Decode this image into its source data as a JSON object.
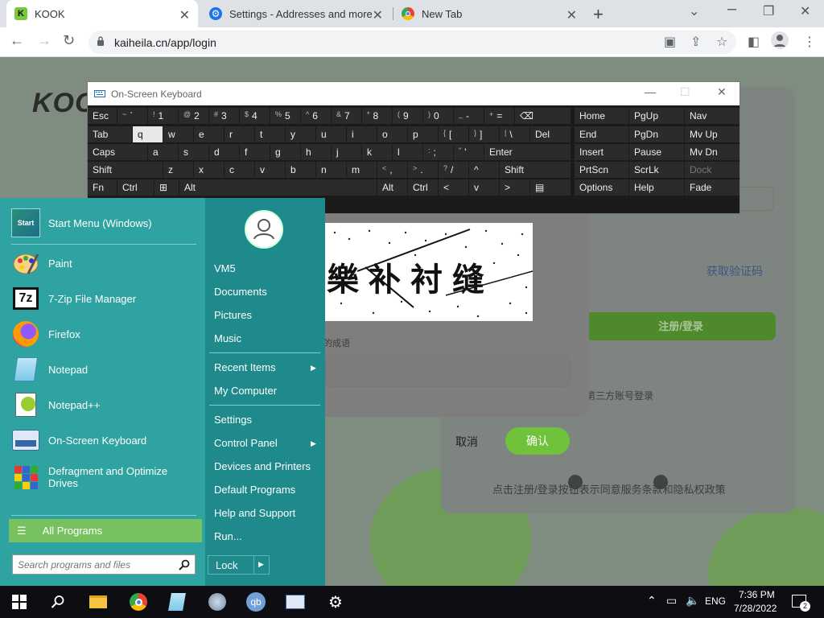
{
  "browser": {
    "tabs": [
      {
        "title": "KOOK",
        "icon": "kook-icon"
      },
      {
        "title": "Settings - Addresses and more",
        "icon": "gear-icon"
      },
      {
        "title": "New Tab",
        "icon": "chrome-icon"
      }
    ],
    "url": "kaiheila.cn/app/login"
  },
  "page": {
    "logo": "KOO",
    "get_code": "获取验证码",
    "login_button": "注册/登录",
    "third_party": "第三方账号登录",
    "terms": "点击注册/登录按钮表示同意服务条款和隐私权政策"
  },
  "captcha_dialog": {
    "captcha_text": "樂补衬缝",
    "hint": "的成语",
    "cancel_label": "取消",
    "confirm_label": "确认"
  },
  "osk": {
    "title": "On-Screen Keyboard",
    "keys": {
      "row1": [
        "Esc",
        "`",
        "1",
        "2",
        "3",
        "4",
        "5",
        "6",
        "7",
        "8",
        "9",
        "0",
        "-",
        "=",
        "⌫"
      ],
      "row1_shift": [
        "",
        "~",
        "!",
        "@",
        "#",
        "$",
        "%",
        "^",
        "&",
        "*",
        "(",
        ")",
        "_",
        "+",
        ""
      ],
      "row2": [
        "Tab",
        "q",
        "w",
        "e",
        "r",
        "t",
        "y",
        "u",
        "i",
        "o",
        "p",
        "[",
        "]",
        "\\",
        "Del"
      ],
      "row2_shift": [
        "",
        "",
        "",
        "",
        "",
        "",
        "",
        "",
        "",
        "",
        "",
        "{",
        "}",
        "|",
        ""
      ],
      "row3": [
        "Caps",
        "a",
        "s",
        "d",
        "f",
        "g",
        "h",
        "j",
        "k",
        "l",
        ";",
        "'",
        "Enter"
      ],
      "row3_shift": [
        "",
        "",
        "",
        "",
        "",
        "",
        "",
        "",
        "",
        "",
        ":",
        "\"",
        ""
      ],
      "row4": [
        "Shift",
        "z",
        "x",
        "c",
        "v",
        "b",
        "n",
        "m",
        ",",
        ".",
        "/",
        "^",
        "Shift"
      ],
      "row4_shift": [
        "",
        "",
        "",
        "",
        "",
        "",
        "",
        "",
        "<",
        ">",
        "?",
        "",
        ""
      ],
      "row5": [
        "Fn",
        "Ctrl",
        "⊞",
        "Alt",
        "Alt",
        "Ctrl",
        "<",
        "v",
        ">",
        "▤"
      ],
      "nav_col1": [
        "Home",
        "End",
        "Insert",
        "PrtScn",
        "Options"
      ],
      "nav_col2": [
        "PgUp",
        "PgDn",
        "Pause",
        "ScrLk",
        "Help"
      ],
      "nav_col3": [
        "Nav",
        "Mv Up",
        "Mv Dn",
        "Dock",
        "Fade"
      ]
    }
  },
  "start_menu": {
    "programs": [
      {
        "label": "Start Menu (Windows)",
        "icon": "start-menu-icon"
      },
      {
        "label": "Paint",
        "icon": "paint-icon"
      },
      {
        "label": "7-Zip File Manager",
        "icon": "7zip-icon"
      },
      {
        "label": "Firefox",
        "icon": "firefox-icon"
      },
      {
        "label": "Notepad",
        "icon": "notepad-icon"
      },
      {
        "label": "Notepad++",
        "icon": "notepadpp-icon"
      },
      {
        "label": "On-Screen Keyboard",
        "icon": "keyboard-icon"
      },
      {
        "label": "Defragment and Optimize Drives",
        "icon": "defrag-icon"
      }
    ],
    "start_icon_text": "Start",
    "all_programs": "All Programs",
    "search_placeholder": "Search programs and files",
    "right_items": [
      "VM5",
      "Documents",
      "Pictures",
      "Music",
      "Recent Items",
      "My Computer",
      "Settings",
      "Control Panel",
      "Devices and Printers",
      "Default Programs",
      "Help and Support",
      "Run..."
    ],
    "lock": "Lock"
  },
  "taskbar": {
    "language": "ENG",
    "time": "7:36 PM",
    "date": "7/28/2022",
    "notification_count": "2"
  },
  "colors": {
    "start_left": "#2ea3a1",
    "start_right": "#1e8a8c",
    "all_programs": "#77c25f",
    "confirm": "#6fc23a"
  }
}
